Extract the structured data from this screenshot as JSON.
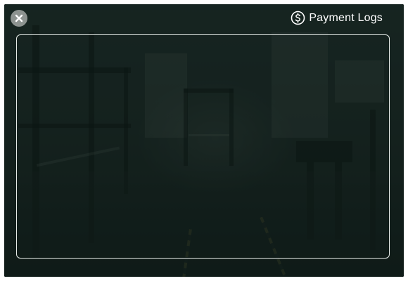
{
  "header": {
    "title": "Payment Logs",
    "title_icon": "dollar-circle-icon"
  },
  "controls": {
    "close_icon": "close-icon"
  },
  "colors": {
    "overlay": "#0c1c18",
    "panel_border": "#e6ebe8",
    "close_button_bg": "#8d9390",
    "text": "#ffffff"
  },
  "content": {
    "log_entries": []
  }
}
